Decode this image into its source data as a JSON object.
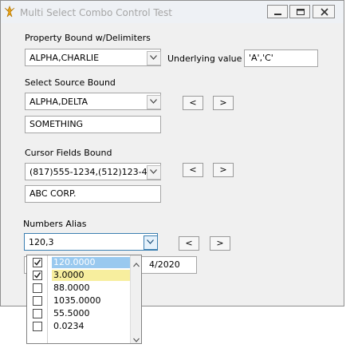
{
  "window": {
    "title": "Multi Select Combo Control Test",
    "controls": [
      "minimize",
      "maximize",
      "close"
    ]
  },
  "property_bound": {
    "label": "Property Bound w/Delimiters",
    "combo_value": "ALPHA,CHARLIE",
    "underlying_label": "Underlying value",
    "underlying_value": "'A','C'"
  },
  "select_source": {
    "label": "Select Source Bound",
    "combo_value": "ALPHA,DELTA",
    "text_value": "SOMETHING",
    "prev_label": "<",
    "next_label": ">"
  },
  "cursor_fields": {
    "label": "Cursor Fields Bound",
    "combo_value": "(817)555-1234,(512)123-4",
    "text_value": "ABC CORP.",
    "prev_label": "<",
    "next_label": ">"
  },
  "numbers_alias": {
    "label": "Numbers Alias",
    "combo_value": "120,3",
    "prev_label": "<",
    "next_label": ">",
    "partial_field_value": "4/2020"
  },
  "dropdown": {
    "items": [
      {
        "label": "120.0000",
        "checked": true,
        "highlight": "selected"
      },
      {
        "label": "3.0000",
        "checked": true,
        "highlight": "checked"
      },
      {
        "label": "88.0000",
        "checked": false
      },
      {
        "label": "1035.0000",
        "checked": false
      },
      {
        "label": "55.5000",
        "checked": false
      },
      {
        "label": "0.0234",
        "checked": false
      }
    ]
  },
  "colors": {
    "selected_row": "#99c9ef",
    "checked_row": "#f7ee9e",
    "title_text": "#a6a6a6",
    "window_bg": "#f0f0f0"
  }
}
